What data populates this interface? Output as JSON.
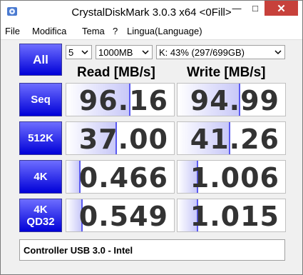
{
  "window": {
    "title": "CrystalDiskMark 3.0.3 x64 <0Fill>",
    "controls": {
      "minimize": "—",
      "maximize": "□",
      "close": "✕"
    }
  },
  "menu": [
    "File",
    "Modifica",
    "Tema",
    "?",
    "Lingua(Language)"
  ],
  "toolbar": {
    "all_label": "All",
    "count": "5",
    "size": "1000MB",
    "drive": "K: 43% (297/699GB)"
  },
  "headers": {
    "read": "Read [MB/s]",
    "write": "Write [MB/s]"
  },
  "rows": [
    {
      "label": "Seq",
      "read": "96.16",
      "write": "94.99",
      "read_fill": 0.58,
      "write_fill": 0.57
    },
    {
      "label": "512K",
      "read": "37.00",
      "write": "41.26",
      "read_fill": 0.46,
      "write_fill": 0.48
    },
    {
      "label": "4K",
      "read": "0.466",
      "write": "1.006",
      "read_fill": 0.12,
      "write_fill": 0.18
    },
    {
      "label": "4K\nQD32",
      "read": "0.549",
      "write": "1.015",
      "read_fill": 0.14,
      "write_fill": 0.18
    }
  ],
  "status": "Controller USB 3.0 - Intel",
  "colors": {
    "button_top": "#6d6dff",
    "button_bottom": "#0000d8",
    "close": "#c7413b",
    "value_text": "#333333"
  }
}
